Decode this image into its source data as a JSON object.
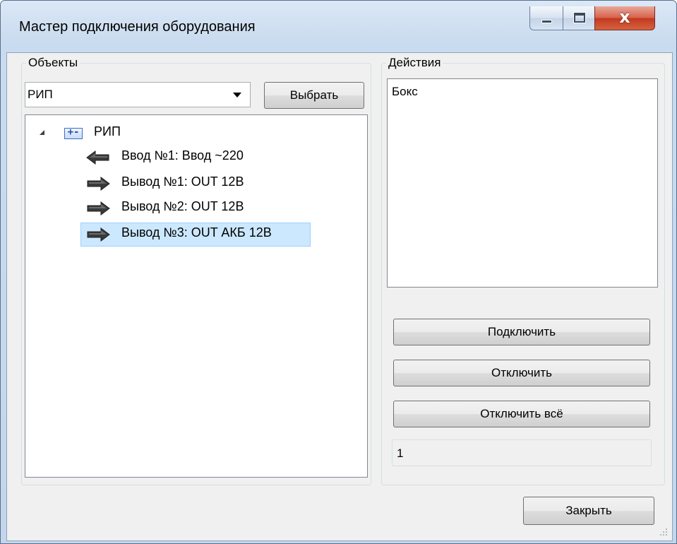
{
  "window": {
    "title": "Мастер подключения оборудования",
    "close_glyph": "x"
  },
  "objects": {
    "group_label": "Объекты",
    "combo_value": "РИП",
    "select_button": "Выбрать",
    "tree": {
      "root_label": "РИП",
      "root_icon_text": "+-",
      "items": [
        {
          "label": "Ввод №1: Ввод ~220",
          "icon": "arrow-left-icon",
          "selected": false
        },
        {
          "label": "Вывод №1: OUT 12В",
          "icon": "arrow-right-icon",
          "selected": false
        },
        {
          "label": "Вывод №2: OUT 12В",
          "icon": "arrow-right-icon",
          "selected": false
        },
        {
          "label": "Вывод №3: OUT АКБ 12В",
          "icon": "arrow-right-icon",
          "selected": true
        }
      ]
    }
  },
  "actions": {
    "group_label": "Действия",
    "list_items": [
      "Бокс"
    ],
    "connect_button": "Подключить",
    "disconnect_button": "Отключить",
    "disconnect_all_button": "Отключить всё",
    "status_value": "1"
  },
  "footer": {
    "close_button": "Закрыть"
  },
  "colors": {
    "selection": "#cce8ff",
    "close_caption": "#c3381e"
  }
}
